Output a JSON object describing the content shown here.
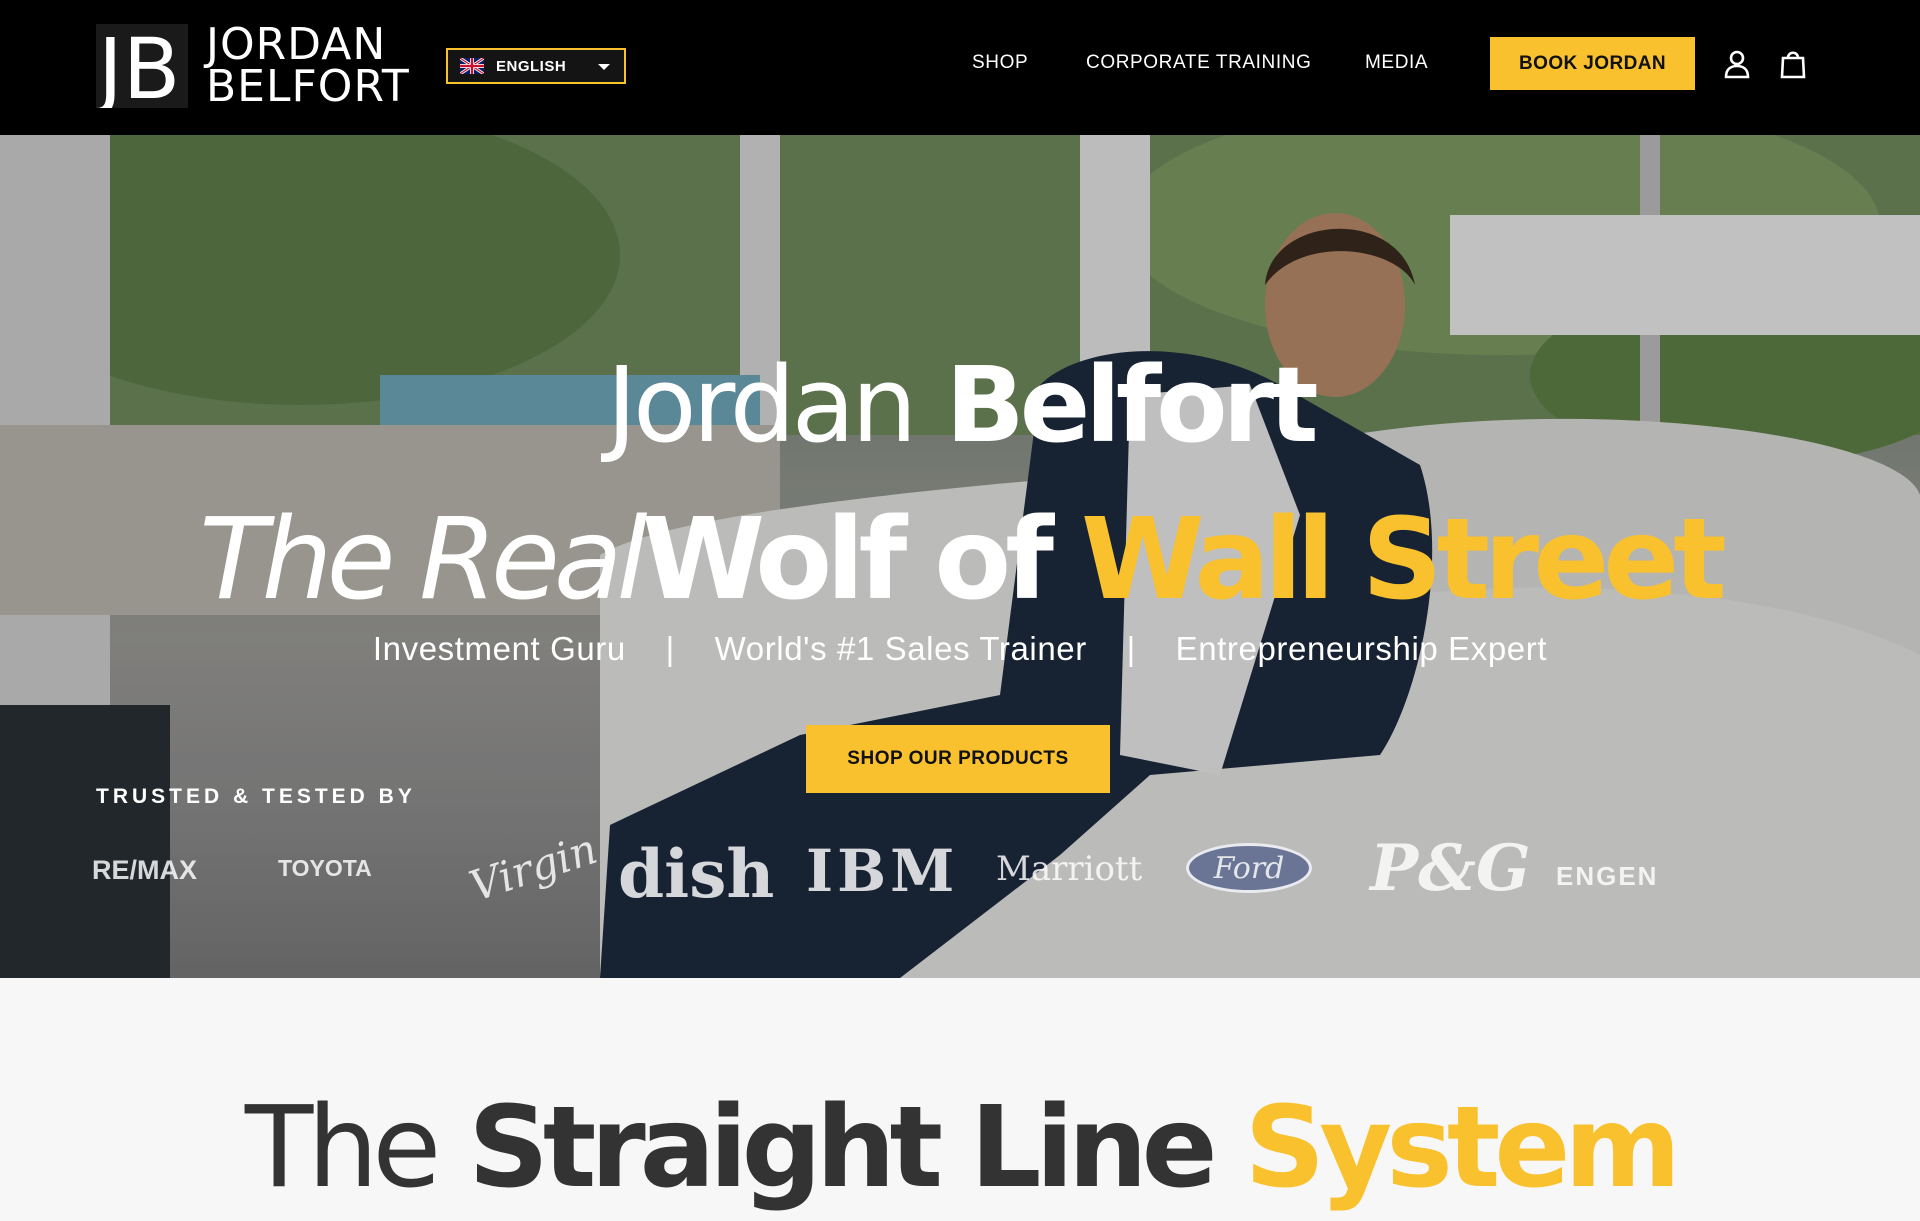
{
  "colors": {
    "accent": "#f9c12e",
    "header_bg": "#000000",
    "text_dark": "#333333"
  },
  "header": {
    "logo_mark": "JB",
    "logo_line1": "JORDAN",
    "logo_line2": "BELFORT",
    "language": {
      "flag_icon": "uk-flag-icon",
      "selected": "ENGLISH"
    },
    "nav": {
      "shop": "SHOP",
      "corporate_training": "CORPORATE TRAINING",
      "media": "MEDIA"
    },
    "book_label": "BOOK JORDAN",
    "icons": [
      "account-icon",
      "cart-icon"
    ]
  },
  "hero": {
    "title_light": "Jordan",
    "title_bold": "Belfort",
    "tagline_italic": "The Real",
    "tagline_white": "Wolf of",
    "tagline_yellow": "Wall Street",
    "sub_1": "Investment Guru",
    "sub_sep": "|",
    "sub_2": "World's #1 Sales Trainer",
    "sub_3": "Entrepreneurship Expert",
    "cta": "SHOP OUR PRODUCTS",
    "trusted_label": "TRUSTED & TESTED BY",
    "brands": [
      "RE/MAX",
      "TOYOTA",
      "Virgin",
      "dish",
      "IBM",
      "Marriott",
      "Ford",
      "P&G",
      "ENGEN"
    ]
  },
  "section2": {
    "title_light": "The",
    "title_bold": "Straight Line",
    "title_yellow": "System"
  }
}
